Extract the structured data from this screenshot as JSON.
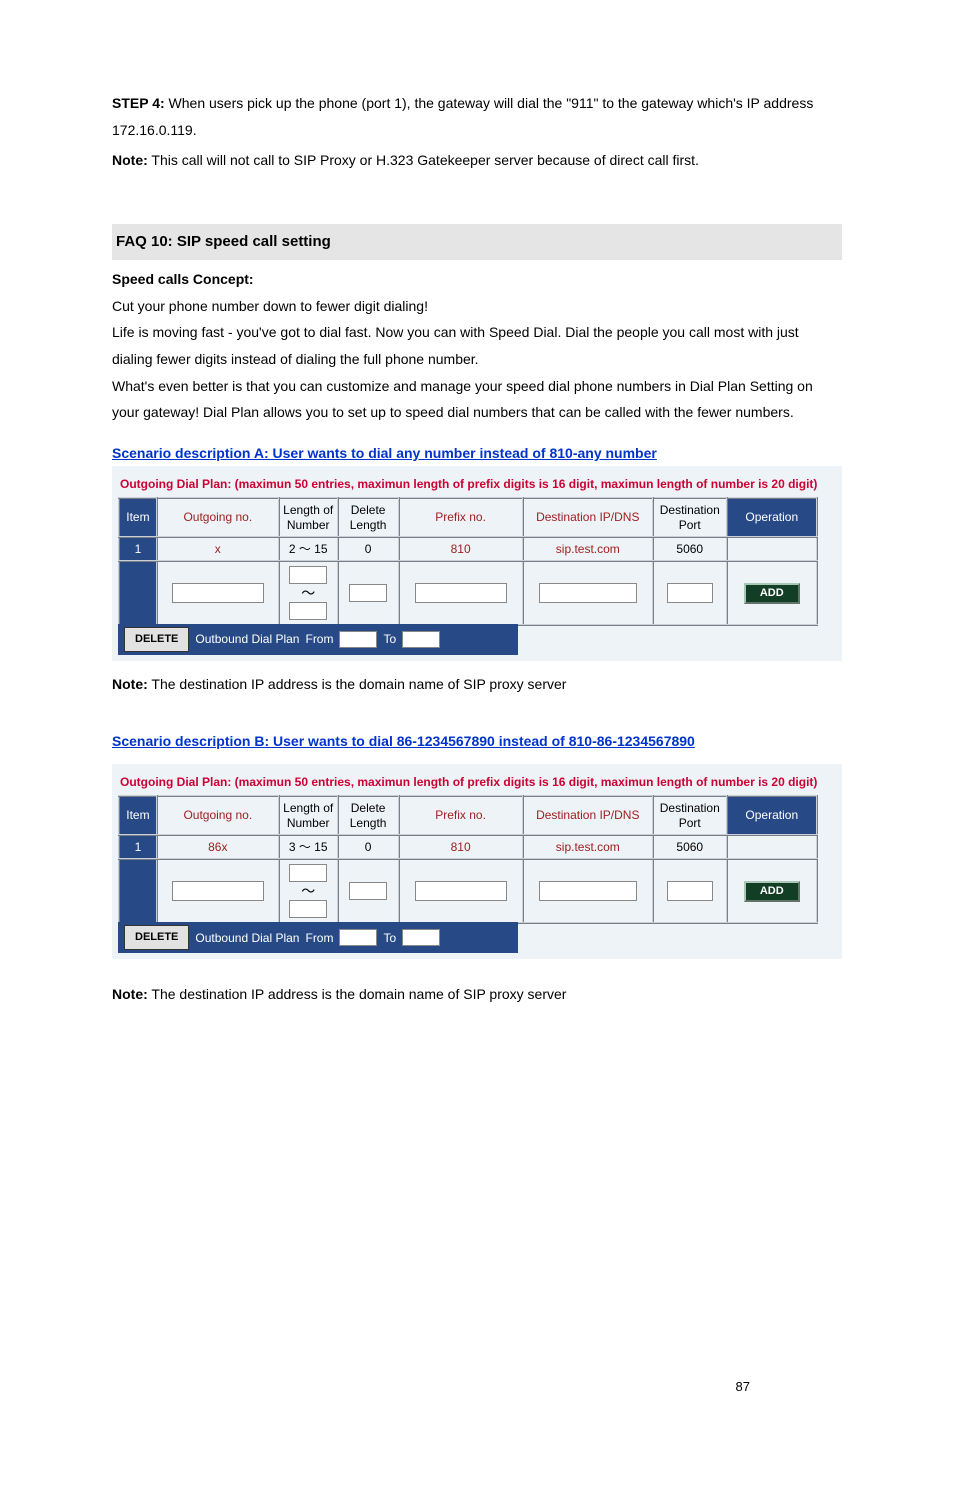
{
  "intro": {
    "step4_label": "STEP 4:",
    "step4_text": " When users pick up the phone (port 1), the gateway will dial the \"911\" to the gateway which's IP address 172.16.0.119.",
    "note_label": "Note:",
    "note_text": " This call will not call to SIP Proxy or H.323 Gatekeeper server because of direct call first."
  },
  "faq": {
    "heading": "FAQ 10: SIP speed call setting",
    "concept_title": "Speed calls Concept:",
    "p1": "Cut your phone number down to fewer digit dialing!",
    "p2": "Life is moving fast - you've got to dial fast. Now you can with Speed Dial. Dial the people you call most with just dialing fewer digits instead of dialing the full phone number.",
    "p3": "What's even better is that you can customize and manage your speed dial phone numbers in Dial Plan Setting on your gateway!   Dial Plan allows you to set up to speed dial numbers that can be called with the fewer numbers."
  },
  "scenarioA": {
    "title": "Scenario description A: User wants to dial any number instead of 810-any number",
    "caption": "Outgoing Dial Plan: (maximun 50 entries, maximun length of prefix digits is 16 digit, maximun length of number is 20 digit)",
    "headers": {
      "item": "Item",
      "out": "Outgoing no.",
      "len": "Length of Number",
      "del": "Delete Length",
      "pfx": "Prefix no.",
      "ip": "Destination IP/DNS",
      "port": "Destination Port",
      "op": "Operation"
    },
    "row": {
      "item": "1",
      "out": "x",
      "len": "2 ～ 15",
      "del": "0",
      "pfx": "810",
      "ip": "sip.test.com",
      "port": "5060"
    },
    "add_label": "ADD",
    "delete_label": "DELETE",
    "obp_label": "Outbound Dial Plan",
    "from_label": "From",
    "to_label": "To",
    "note_label": "Note:",
    "note_text": " The destination IP address is the domain name of SIP proxy server"
  },
  "scenarioB": {
    "title": "Scenario description B: User wants to dial 86-1234567890 instead of 810-86-1234567890",
    "caption": "Outgoing Dial Plan: (maximun 50 entries, maximun length of prefix digits is 16 digit, maximun length of number is 20 digit)",
    "headers": {
      "item": "Item",
      "out": "Outgoing no.",
      "len": "Length of Number",
      "del": "Delete Length",
      "pfx": "Prefix no.",
      "ip": "Destination IP/DNS",
      "port": "Destination Port",
      "op": "Operation"
    },
    "row": {
      "item": "1",
      "out": "86x",
      "len": "3 ～ 15",
      "del": "0",
      "pfx": "810",
      "ip": "sip.test.com",
      "port": "5060"
    },
    "add_label": "ADD",
    "delete_label": "DELETE",
    "obp_label": "Outbound Dial Plan",
    "from_label": "From",
    "to_label": "To",
    "note_label": "Note:",
    "note_text": " The destination IP address is the domain name of SIP proxy server"
  },
  "page_number": "87"
}
